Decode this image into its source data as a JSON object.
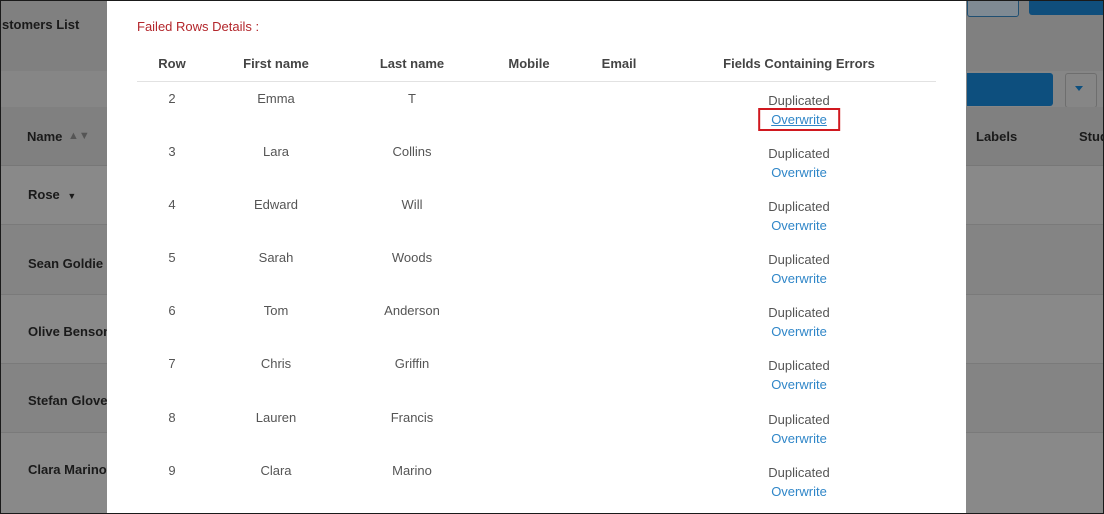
{
  "background": {
    "page_title": "stomers List",
    "columns": [
      "Name",
      "Labels",
      "Stud"
    ],
    "filter_label": "Rose",
    "rows": [
      "Sean Goldie",
      "Olive Benson",
      "Stefan Glover",
      "Clara Marino"
    ]
  },
  "modal": {
    "title": "Failed Rows Details :",
    "headers": {
      "row": "Row",
      "first_name": "First name",
      "last_name": "Last name",
      "mobile": "Mobile",
      "email": "Email",
      "errors": "Fields Containing Errors"
    },
    "rows": [
      {
        "row": "2",
        "first_name": "Emma",
        "last_name": "T",
        "mobile": "",
        "email": "",
        "error": "Duplicated",
        "action": "Overwrite"
      },
      {
        "row": "3",
        "first_name": "Lara",
        "last_name": "Collins",
        "mobile": "",
        "email": "",
        "error": "Duplicated",
        "action": "Overwrite"
      },
      {
        "row": "4",
        "first_name": "Edward",
        "last_name": "Will",
        "mobile": "",
        "email": "",
        "error": "Duplicated",
        "action": "Overwrite"
      },
      {
        "row": "5",
        "first_name": "Sarah",
        "last_name": "Woods",
        "mobile": "",
        "email": "",
        "error": "Duplicated",
        "action": "Overwrite"
      },
      {
        "row": "6",
        "first_name": "Tom",
        "last_name": "Anderson",
        "mobile": "",
        "email": "",
        "error": "Duplicated",
        "action": "Overwrite"
      },
      {
        "row": "7",
        "first_name": "Chris",
        "last_name": "Griffin",
        "mobile": "",
        "email": "",
        "error": "Duplicated",
        "action": "Overwrite"
      },
      {
        "row": "8",
        "first_name": "Lauren",
        "last_name": "Francis",
        "mobile": "",
        "email": "",
        "error": "Duplicated",
        "action": "Overwrite"
      },
      {
        "row": "9",
        "first_name": "Clara",
        "last_name": "Marino",
        "mobile": "",
        "email": "",
        "error": "Duplicated",
        "action": "Overwrite"
      }
    ]
  },
  "colors": {
    "title_red": "#b3262b",
    "link_blue": "#2f86c8",
    "highlight_red": "#d0181f",
    "primary_button": "#0d4f7e"
  }
}
